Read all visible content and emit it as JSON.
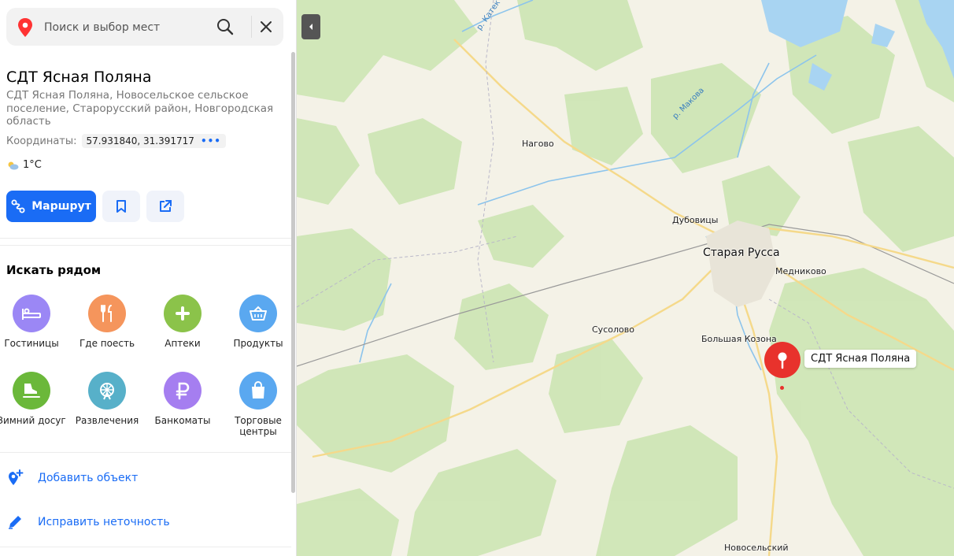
{
  "search": {
    "placeholder": "Поиск и выбор мест"
  },
  "place": {
    "title": "СДТ Ясная Поляна",
    "address": "СДТ Ясная Поляна, Новосельское сельское поселение, Старорусский район, Новгородская область",
    "coords_label": "Координаты:",
    "coords_value": "57.931840, 31.391717",
    "weather": "1°C"
  },
  "actions": {
    "route_label": "Маршрут"
  },
  "nearby": {
    "title": "Искать рядом",
    "categories": [
      {
        "label": "Гостиницы",
        "icon": "bed-icon",
        "color": "#9b87f5"
      },
      {
        "label": "Где поесть",
        "icon": "fork-knife-icon",
        "color": "#f5955c"
      },
      {
        "label": "Аптеки",
        "icon": "plus-icon",
        "color": "#8bc34a"
      },
      {
        "label": "Продукты",
        "icon": "basket-icon",
        "color": "#5aa8f0"
      },
      {
        "label": "Зимний досуг",
        "icon": "skate-icon",
        "color": "#6bb83a"
      },
      {
        "label": "Развлечения",
        "icon": "ferris-wheel-icon",
        "color": "#57b0c9"
      },
      {
        "label": "Банкоматы",
        "icon": "ruble-icon",
        "color": "#a57ef0"
      },
      {
        "label": "Торговые центры",
        "icon": "shopping-bag-icon",
        "color": "#5aa8f0"
      }
    ]
  },
  "footer_actions": {
    "add_object": "Добавить объект",
    "fix_error": "Исправить неточность"
  },
  "map": {
    "towns": {
      "nagovo": "Нагово",
      "dubovitsy": "Дубовицы",
      "staraya_russa": "Старая Русса",
      "medn": "Медниково",
      "susolovo": "Сусолово",
      "bolshaya_kozona": "Большая Козона",
      "novoselsky": "Новосельский"
    },
    "rivers": {
      "katek": "р. Катек",
      "makova": "р. Макова"
    },
    "marker_label": "СДТ Ясная Поляна",
    "marker_color": "#e8322c"
  }
}
